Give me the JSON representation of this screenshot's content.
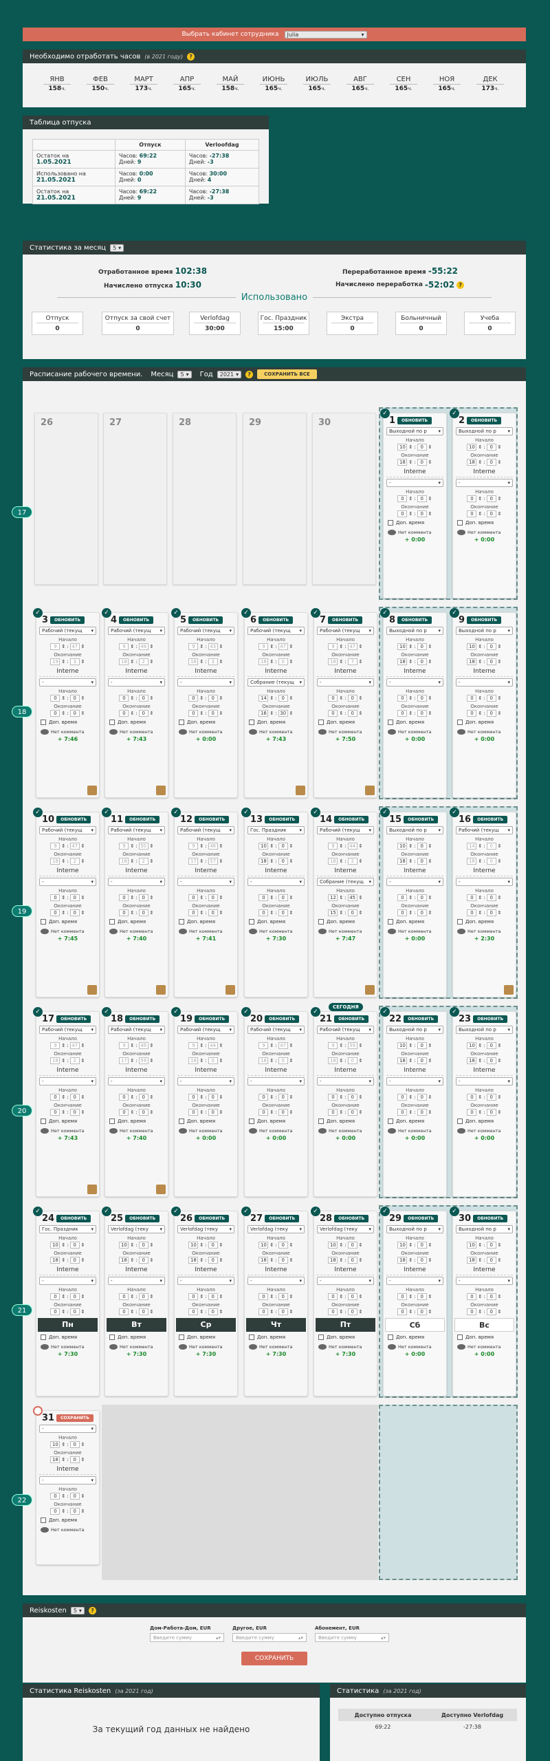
{
  "header": {
    "label": "Выбрать кабинет сотрудника",
    "employee": "Julia"
  },
  "hours": {
    "title": "Необходимо отработать часов",
    "subtitle": "(в 2021 году)",
    "unit": "ч.",
    "months": [
      {
        "m": "ЯНВ",
        "v": "158"
      },
      {
        "m": "ФЕВ",
        "v": "150"
      },
      {
        "m": "МАРТ",
        "v": "173"
      },
      {
        "m": "АПР",
        "v": "165"
      },
      {
        "m": "МАЙ",
        "v": "158"
      },
      {
        "m": "ИЮНЬ",
        "v": "165"
      },
      {
        "m": "ИЮЛЬ",
        "v": "165"
      },
      {
        "m": "АВГ",
        "v": "165"
      },
      {
        "m": "СЕН",
        "v": "165"
      },
      {
        "m": "НОЯ",
        "v": "165"
      },
      {
        "m": "ДЕК",
        "v": "173"
      }
    ]
  },
  "vacation": {
    "title": "Таблица отпуска",
    "col1": "Отпуск",
    "col2": "Verloofdag",
    "hours_label": "Часов:",
    "days_label": "Дней:",
    "rows": [
      {
        "label": "Остаток на",
        "date": "1.05.2021",
        "h1": "69:22",
        "d1": "9",
        "h2": "-27:38",
        "d2": "-3"
      },
      {
        "label": "Использовано на",
        "date": "21.05.2021",
        "h1": "0:00",
        "d1": "0",
        "h2": "30:00",
        "d2": "4"
      },
      {
        "label": "Остаток на",
        "date": "21.05.2021",
        "h1": "69:22",
        "d1": "9",
        "h2": "-27:38",
        "d2": "-3"
      }
    ]
  },
  "stats": {
    "title": "Статистика за месяц",
    "month": "5",
    "worked_label": "Отработанное время",
    "worked": "102:38",
    "vac_label": "Начислено отпуска",
    "vac": "10:30",
    "over_label": "Переработанное время",
    "over": "-55:22",
    "overacc_label": "Начислено переработка",
    "overacc": "-52:02",
    "used_title": "Использовано",
    "boxes": [
      {
        "l": "Отпуск",
        "v": "0"
      },
      {
        "l": "Отпуск за свой счет",
        "v": "0"
      },
      {
        "l": "Verlofdag",
        "v": "30:00"
      },
      {
        "l": "Гос. Праздник",
        "v": "15:00"
      },
      {
        "l": "Экстра",
        "v": "0"
      },
      {
        "l": "Больничный",
        "v": "0"
      },
      {
        "l": "Учеба",
        "v": "0"
      }
    ]
  },
  "schedule": {
    "title": "Расписание рабочего времени.",
    "month_label": "Месяц",
    "month": "5",
    "year_label": "Год",
    "year": "2021",
    "save_all": "СОХРАНИТЬ ВСЕ",
    "update": "ОБНОВИТЬ",
    "save": "СОХРАНИТЬ",
    "start": "Начало",
    "end": "Окончание",
    "interne": "Interne",
    "extra": "Доп. время",
    "no_comment": "Нет коммента",
    "today": "СЕГОДНЯ",
    "dash": "-",
    "weeks": [
      "17",
      "18",
      "19",
      "20",
      "21",
      "22"
    ],
    "prev_days": [
      "26",
      "27",
      "28",
      "29",
      "30"
    ],
    "weekdays": [
      "Пн",
      "Вт",
      "Ср",
      "Чт",
      "Пт",
      "Сб",
      "Вс"
    ]
  },
  "days": [
    {
      "n": "1",
      "type": "Выходной по р",
      "s": "10",
      "sm": "0",
      "e": "18",
      "em": "0",
      "ib": "-",
      "is": "0",
      "ism": "0",
      "ie": "0",
      "iem": "0",
      "tot": "+ 0:00"
    },
    {
      "n": "2",
      "type": "Выходной по р",
      "s": "10",
      "sm": "0",
      "e": "18",
      "em": "0",
      "ib": "-",
      "is": "0",
      "ism": "0",
      "ie": "0",
      "iem": "0",
      "tot": "+ 0:00"
    },
    {
      "n": "3",
      "type": "Рабочий (текущ",
      "s": "9",
      "sm": "47",
      "e": "19",
      "em": "3",
      "ib": "-",
      "is": "0",
      "ism": "0",
      "ie": "0",
      "iem": "0",
      "tot": "+ 7:46"
    },
    {
      "n": "4",
      "type": "Рабочий (текущ",
      "s": "9",
      "sm": "49",
      "e": "18",
      "em": "2",
      "ib": "-",
      "is": "0",
      "ism": "0",
      "ie": "0",
      "iem": "0",
      "tot": "+ 7:43"
    },
    {
      "n": "5",
      "type": "Рабочий (текущ",
      "s": "9",
      "sm": "43",
      "e": "18",
      "em": "3",
      "ib": "-",
      "is": "0",
      "ism": "0",
      "ie": "0",
      "iem": "0",
      "tot": "+ 0:00"
    },
    {
      "n": "6",
      "type": "Рабочий (текущ",
      "s": "9",
      "sm": "47",
      "e": "18",
      "em": "0",
      "ib": "Собрание (текущ",
      "is": "14",
      "ism": "0",
      "ie": "16",
      "iem": "30",
      "tot": "+ 7:43"
    },
    {
      "n": "7",
      "type": "Рабочий (текущ",
      "s": "9",
      "sm": "47",
      "e": "18",
      "em": "7",
      "ib": "-",
      "is": "0",
      "ism": "0",
      "ie": "0",
      "iem": "0",
      "tot": "+ 7:50"
    },
    {
      "n": "8",
      "type": "Выходной по р",
      "s": "10",
      "sm": "0",
      "e": "18",
      "em": "0",
      "ib": "-",
      "is": "0",
      "ism": "0",
      "ie": "0",
      "iem": "0",
      "tot": "+ 0:00"
    },
    {
      "n": "9",
      "type": "Выходной по р",
      "s": "10",
      "sm": "0",
      "e": "18",
      "em": "0",
      "ib": "-",
      "is": "0",
      "ism": "0",
      "ie": "0",
      "iem": "0",
      "tot": "+ 0:00"
    },
    {
      "n": "10",
      "type": "Рабочий (текущ",
      "s": "9",
      "sm": "47",
      "e": "18",
      "em": "2",
      "ib": "-",
      "is": "0",
      "ism": "0",
      "ie": "0",
      "iem": "0",
      "tot": "+ 7:45"
    },
    {
      "n": "11",
      "type": "Рабочий (текущ",
      "s": "9",
      "sm": "50",
      "e": "18",
      "em": "2",
      "ib": "-",
      "is": "0",
      "ism": "0",
      "ie": "0",
      "iem": "0",
      "tot": "+ 7:40"
    },
    {
      "n": "12",
      "type": "Рабочий (текущ",
      "s": "9",
      "sm": "46",
      "e": "17",
      "em": "57",
      "ib": "-",
      "is": "0",
      "ism": "0",
      "ie": "0",
      "iem": "0",
      "tot": "+ 7:41"
    },
    {
      "n": "13",
      "type": "Гос. Праздник",
      "s": "10",
      "sm": "0",
      "e": "18",
      "em": "0",
      "ib": "-",
      "is": "0",
      "ism": "0",
      "ie": "0",
      "iem": "0",
      "tot": "+ 7:30"
    },
    {
      "n": "14",
      "type": "Рабочий (текущ",
      "s": "9",
      "sm": "44",
      "e": "18",
      "em": "2",
      "ib": "Собрание (текущ",
      "is": "12",
      "ism": "45",
      "ie": "15",
      "iem": "0",
      "tot": "+ 7:47"
    },
    {
      "n": "15",
      "type": "Выходной по р",
      "s": "10",
      "sm": "0",
      "e": "18",
      "em": "0",
      "ib": "-",
      "is": "0",
      "ism": "0",
      "ie": "0",
      "iem": "0",
      "tot": "+ 0:00"
    },
    {
      "n": "16",
      "type": "Рабочий (текущ",
      "s": "14",
      "sm": "0",
      "e": "18",
      "em": "0",
      "ib": "-",
      "is": "0",
      "ism": "0",
      "ie": "0",
      "iem": "0",
      "tot": "+ 2:30"
    },
    {
      "n": "17",
      "type": "Рабочий (текущ",
      "s": "9",
      "sm": "47",
      "e": "18",
      "em": "2",
      "ib": "-",
      "is": "0",
      "ism": "0",
      "ie": "0",
      "iem": "0",
      "tot": "+ 7:43"
    },
    {
      "n": "18",
      "type": "Рабочий (текущ",
      "s": "9",
      "sm": "49",
      "e": "17",
      "em": "59",
      "ib": "-",
      "is": "0",
      "ism": "0",
      "ie": "0",
      "iem": "0",
      "tot": "+ 7:40"
    },
    {
      "n": "19",
      "type": "Рабочий (текущ",
      "s": "9",
      "sm": "44",
      "e": "18",
      "em": "0",
      "ib": "-",
      "is": "0",
      "ism": "0",
      "ie": "0",
      "iem": "0",
      "tot": "+ 0:00"
    },
    {
      "n": "20",
      "type": "Рабочий (текущ",
      "s": "9",
      "sm": "47",
      "e": "18",
      "em": "0",
      "ib": "-",
      "is": "0",
      "ism": "0",
      "ie": "0",
      "iem": "0",
      "tot": "+ 0:00"
    },
    {
      "n": "21",
      "type": "Рабочий (текущ",
      "s": "9",
      "sm": "59",
      "e": "18",
      "em": "0",
      "ib": "-",
      "is": "0",
      "ism": "0",
      "ie": "0",
      "iem": "0",
      "tot": "+ 0:00"
    },
    {
      "n": "22",
      "type": "Выходной по р",
      "s": "10",
      "sm": "0",
      "e": "18",
      "em": "0",
      "ib": "-",
      "is": "0",
      "ism": "0",
      "ie": "0",
      "iem": "0",
      "tot": "+ 0:00"
    },
    {
      "n": "23",
      "type": "Выходной по р",
      "s": "10",
      "sm": "0",
      "e": "18",
      "em": "0",
      "ib": "-",
      "is": "0",
      "ism": "0",
      "ie": "0",
      "iem": "0",
      "tot": "+ 0:00"
    },
    {
      "n": "24",
      "type": "Гос. Праздник",
      "s": "10",
      "sm": "0",
      "e": "18",
      "em": "0",
      "ib": "-",
      "is": "0",
      "ism": "0",
      "ie": "0",
      "iem": "0",
      "tot": "+ 7:30"
    },
    {
      "n": "25",
      "type": "Verlofdag (теку",
      "s": "10",
      "sm": "0",
      "e": "18",
      "em": "0",
      "ib": "-",
      "is": "0",
      "ism": "0",
      "ie": "0",
      "iem": "0",
      "tot": "+ 7:30"
    },
    {
      "n": "26",
      "type": "Verlofdag (теку",
      "s": "10",
      "sm": "0",
      "e": "18",
      "em": "0",
      "ib": "-",
      "is": "0",
      "ism": "0",
      "ie": "0",
      "iem": "0",
      "tot": "+ 7:30"
    },
    {
      "n": "27",
      "type": "Verlofdag (теку",
      "s": "10",
      "sm": "0",
      "e": "18",
      "em": "0",
      "ib": "-",
      "is": "0",
      "ism": "0",
      "ie": "0",
      "iem": "0",
      "tot": "+ 7:30"
    },
    {
      "n": "28",
      "type": "Verlofdag (теку",
      "s": "10",
      "sm": "0",
      "e": "18",
      "em": "0",
      "ib": "-",
      "is": "0",
      "ism": "0",
      "ie": "0",
      "iem": "0",
      "tot": "+ 7:30"
    },
    {
      "n": "29",
      "type": "Выходной по р",
      "s": "10",
      "sm": "0",
      "e": "18",
      "em": "0",
      "ib": "-",
      "is": "0",
      "ism": "0",
      "ie": "0",
      "iem": "0",
      "tot": "+ 0:00"
    },
    {
      "n": "30",
      "type": "Выходной по р",
      "s": "10",
      "sm": "0",
      "e": "18",
      "em": "0",
      "ib": "-",
      "is": "0",
      "ism": "0",
      "ie": "0",
      "iem": "0",
      "tot": "+ 0:00"
    },
    {
      "n": "31",
      "type": "-",
      "s": "10",
      "sm": "0",
      "e": "18",
      "em": "0",
      "ib": "-",
      "is": "0",
      "ism": "0",
      "ie": "0",
      "iem": "0",
      "tot": ""
    }
  ],
  "reis": {
    "title": "Reiskosten",
    "month": "5",
    "f1": "Дом-Работа-Дом, EUR",
    "f2": "Другое, EUR",
    "f3": "Абонемент, EUR",
    "ph": "Введите сумму",
    "save": "СОХРАНИТЬ"
  },
  "reis_stats": {
    "title": "Статистика Reiskosten",
    "subtitle": "(за 2021 год)",
    "empty": "За текущий год данных не найдено"
  },
  "year_stats": {
    "title": "Статистика",
    "subtitle": "(за 2021 год)",
    "c1": "Доступно отпуска",
    "c2": "Доступно Verlofdag",
    "v1": "69:22",
    "v2": "-27:38"
  }
}
